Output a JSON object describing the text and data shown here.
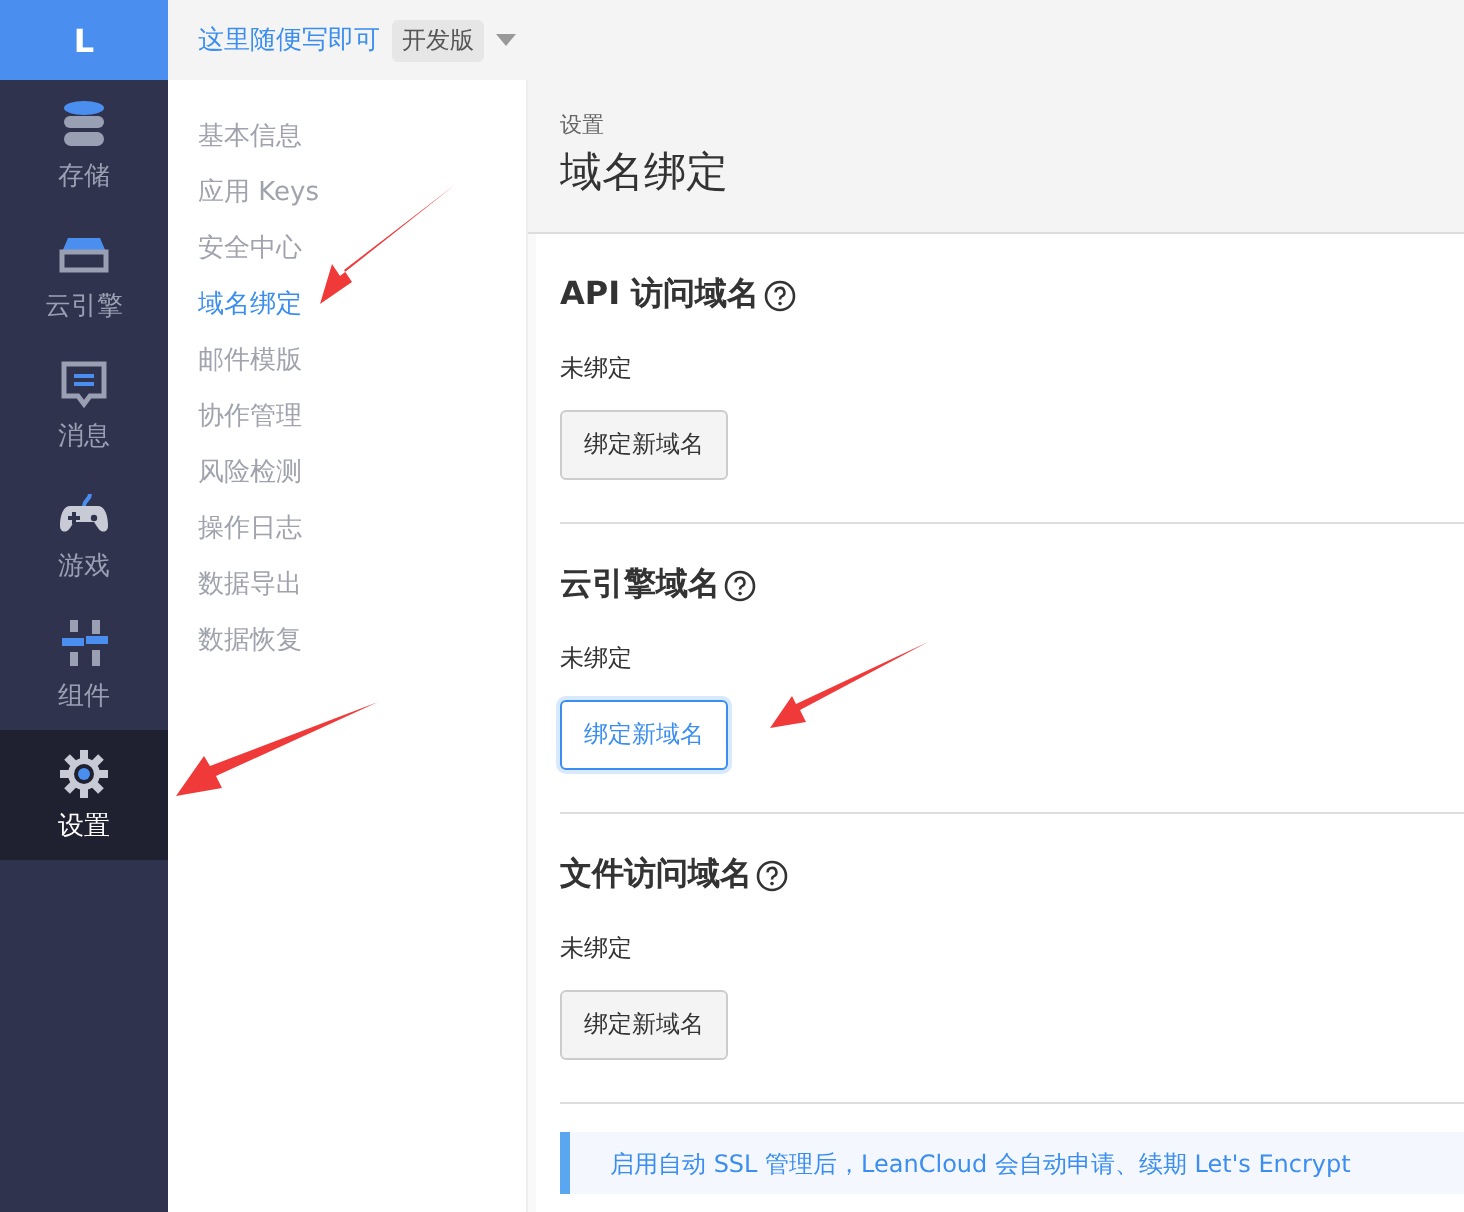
{
  "logo": {
    "letter": "L"
  },
  "top_bar": {
    "app_name": "这里随便写即可",
    "badge": "开发版"
  },
  "nav": [
    {
      "kind": "storage",
      "label": "存储",
      "selected": false
    },
    {
      "kind": "engine",
      "label": "云引擎",
      "selected": false
    },
    {
      "kind": "message",
      "label": "消息",
      "selected": false
    },
    {
      "kind": "game",
      "label": "游戏",
      "selected": false
    },
    {
      "kind": "component",
      "label": "组件",
      "selected": false
    },
    {
      "kind": "settings",
      "label": "设置",
      "selected": true
    }
  ],
  "submenu": [
    {
      "label": "基本信息",
      "selected": false
    },
    {
      "label": "应用 Keys",
      "selected": false
    },
    {
      "label": "安全中心",
      "selected": false
    },
    {
      "label": "域名绑定",
      "selected": true
    },
    {
      "label": "邮件模版",
      "selected": false
    },
    {
      "label": "协作管理",
      "selected": false
    },
    {
      "label": "风险检测",
      "selected": false
    },
    {
      "label": "操作日志",
      "selected": false
    },
    {
      "label": "数据导出",
      "selected": false
    },
    {
      "label": "数据恢复",
      "selected": false
    }
  ],
  "header": {
    "breadcrumb": "设置",
    "title": "域名绑定"
  },
  "sections": [
    {
      "title": "API 访问域名",
      "status": "未绑定",
      "button": "绑定新域名",
      "focused": false
    },
    {
      "title": "云引擎域名",
      "status": "未绑定",
      "button": "绑定新域名",
      "focused": true
    },
    {
      "title": "文件访问域名",
      "status": "未绑定",
      "button": "绑定新域名",
      "focused": false
    }
  ],
  "notice": "启用自动 SSL 管理后，LeanCloud 会自动申请、续期 Let's Encrypt"
}
